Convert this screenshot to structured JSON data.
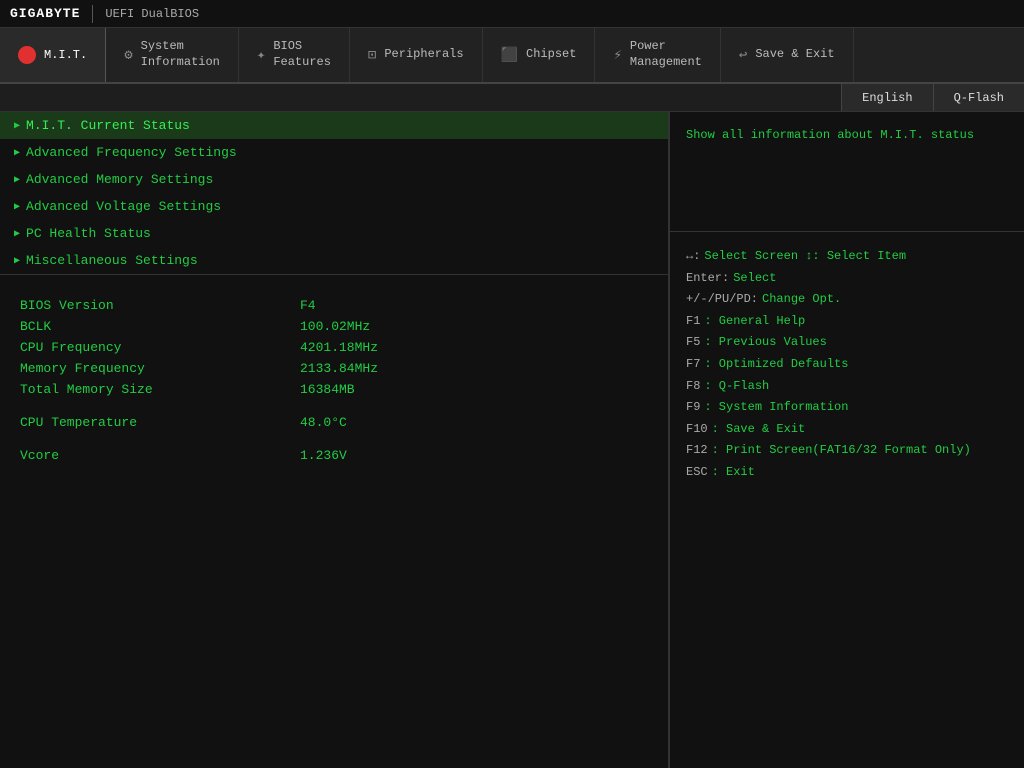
{
  "topbar": {
    "brand": "GIGABYTE",
    "bios_label": "UEFI DualBIOS"
  },
  "navtabs": [
    {
      "id": "mit",
      "label": "M.I.T.",
      "icon": "dot",
      "active": true
    },
    {
      "id": "sysinfo",
      "label1": "System",
      "label2": "Information",
      "icon": "⚙"
    },
    {
      "id": "bios",
      "label1": "BIOS",
      "label2": "Features",
      "icon": "✦"
    },
    {
      "id": "peripherals",
      "label1": "Peripherals",
      "label2": "",
      "icon": "⊡"
    },
    {
      "id": "chipset",
      "label1": "Chipset",
      "label2": "",
      "icon": "⬛"
    },
    {
      "id": "power",
      "label1": "Power",
      "label2": "Management",
      "icon": "⚡"
    },
    {
      "id": "saveexit",
      "label1": "Save & Exit",
      "label2": "",
      "icon": "↩"
    }
  ],
  "lang_buttons": [
    {
      "id": "english",
      "label": "English"
    },
    {
      "id": "qflash",
      "label": "Q-Flash"
    }
  ],
  "menu_items": [
    {
      "id": "mit-current",
      "label": "M.I.T. Current Status",
      "selected": true
    },
    {
      "id": "adv-freq",
      "label": "Advanced Frequency Settings",
      "selected": false
    },
    {
      "id": "adv-mem",
      "label": "Advanced Memory Settings",
      "selected": false
    },
    {
      "id": "adv-volt",
      "label": "Advanced Voltage Settings",
      "selected": false
    },
    {
      "id": "pc-health",
      "label": "PC Health Status",
      "selected": false
    },
    {
      "id": "misc",
      "label": "Miscellaneous Settings",
      "selected": false
    }
  ],
  "info_rows": [
    {
      "label": "BIOS Version",
      "value": "F4"
    },
    {
      "label": "BCLK",
      "value": "100.02MHz"
    },
    {
      "label": "CPU Frequency",
      "value": "4201.18MHz"
    },
    {
      "label": "Memory Frequency",
      "value": "2133.84MHz"
    },
    {
      "label": "Total Memory Size",
      "value": "16384MB"
    },
    {
      "spacer": true
    },
    {
      "label": "CPU Temperature",
      "value": "48.0°C"
    },
    {
      "spacer": true
    },
    {
      "label": "Vcore",
      "value": "1.236V"
    }
  ],
  "description": "Show all information about M.I.T. status",
  "help_rows": [
    {
      "key": "↔:",
      "desc": "Select Screen  ↕: Select Item"
    },
    {
      "key": "Enter:",
      "desc": "Select"
    },
    {
      "key": "+/-/PU/PD:",
      "desc": "Change Opt."
    },
    {
      "key": "F1",
      "desc": ": General Help"
    },
    {
      "key": "F5",
      "desc": ": Previous Values"
    },
    {
      "key": "F7",
      "desc": ": Optimized Defaults"
    },
    {
      "key": "F8",
      "desc": ": Q-Flash"
    },
    {
      "key": "F9",
      "desc": ": System Information"
    },
    {
      "key": "F10",
      "desc": ": Save & Exit"
    },
    {
      "key": "F12",
      "desc": ": Print Screen(FAT16/32 Format Only)"
    },
    {
      "key": "ESC",
      "desc": ": Exit"
    }
  ]
}
